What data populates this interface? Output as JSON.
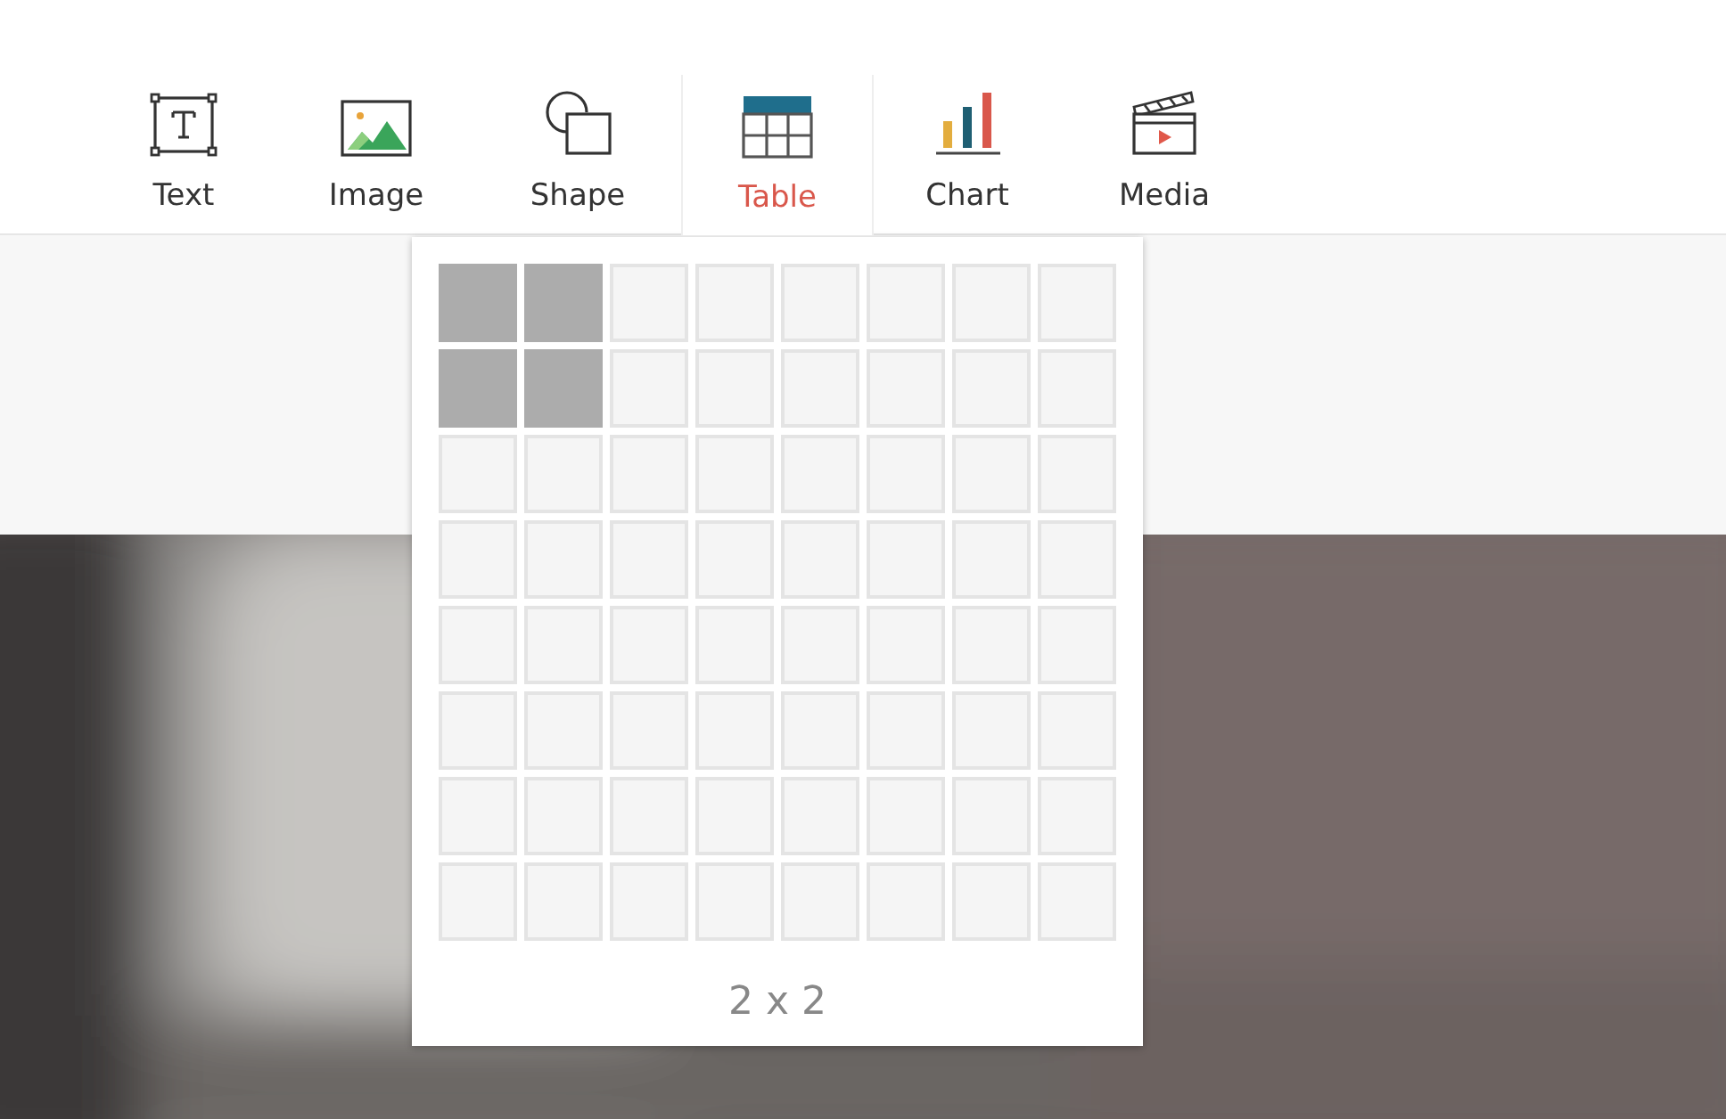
{
  "toolbar": [
    {
      "kind": "text",
      "label": "Text",
      "selected": false
    },
    {
      "label": "Image",
      "selected": false
    },
    {
      "kind": "shape",
      "label": "Shape",
      "selected": false
    },
    {
      "kind": "table",
      "label": "Table",
      "selected": true
    },
    {
      "kind": "chart",
      "label": "Chart",
      "selected": false
    },
    {
      "kind": "media",
      "label": "Media",
      "selected": false
    }
  ],
  "table_picker": {
    "grid": [
      [
        {
          "selected": true
        },
        {
          "selected": true
        },
        {
          "selected": false
        },
        {
          "selected": false
        },
        {
          "selected": false
        },
        {
          "selected": false
        },
        {
          "selected": false
        },
        {
          "selected": false
        }
      ],
      [
        {
          "selected": true
        },
        {
          "selected": true
        },
        {
          "selected": false
        },
        {
          "selected": false
        },
        {
          "selected": false
        },
        {
          "selected": false
        },
        {
          "selected": false
        },
        {
          "selected": false
        }
      ],
      [
        {
          "selected": false
        },
        {
          "selected": false
        },
        {
          "selected": false
        },
        {
          "selected": false
        },
        {
          "selected": false
        },
        {
          "selected": false
        },
        {
          "selected": false
        },
        {
          "selected": false
        }
      ],
      [
        {
          "selected": false
        },
        {
          "selected": false
        },
        {
          "selected": false
        },
        {
          "selected": false
        },
        {
          "selected": false
        },
        {
          "selected": false
        },
        {
          "selected": false
        },
        {
          "selected": false
        }
      ],
      [
        {
          "selected": false
        },
        {
          "selected": false
        },
        {
          "selected": false
        },
        {
          "selected": false
        },
        {
          "selected": false
        },
        {
          "selected": false
        },
        {
          "selected": false
        },
        {
          "selected": false
        }
      ],
      [
        {
          "selected": false
        },
        {
          "selected": false
        },
        {
          "selected": false
        },
        {
          "selected": false
        },
        {
          "selected": false
        },
        {
          "selected": false
        },
        {
          "selected": false
        },
        {
          "selected": false
        }
      ],
      [
        {
          "selected": false
        },
        {
          "selected": false
        },
        {
          "selected": false
        },
        {
          "selected": false
        },
        {
          "selected": false
        },
        {
          "selected": false
        },
        {
          "selected": false
        },
        {
          "selected": false
        }
      ],
      [
        {
          "selected": false
        },
        {
          "selected": false
        },
        {
          "selected": false
        },
        {
          "selected": false
        },
        {
          "selected": false
        },
        {
          "selected": false
        },
        {
          "selected": false
        },
        {
          "selected": false
        }
      ]
    ],
    "size_label": "2 x 2"
  }
}
